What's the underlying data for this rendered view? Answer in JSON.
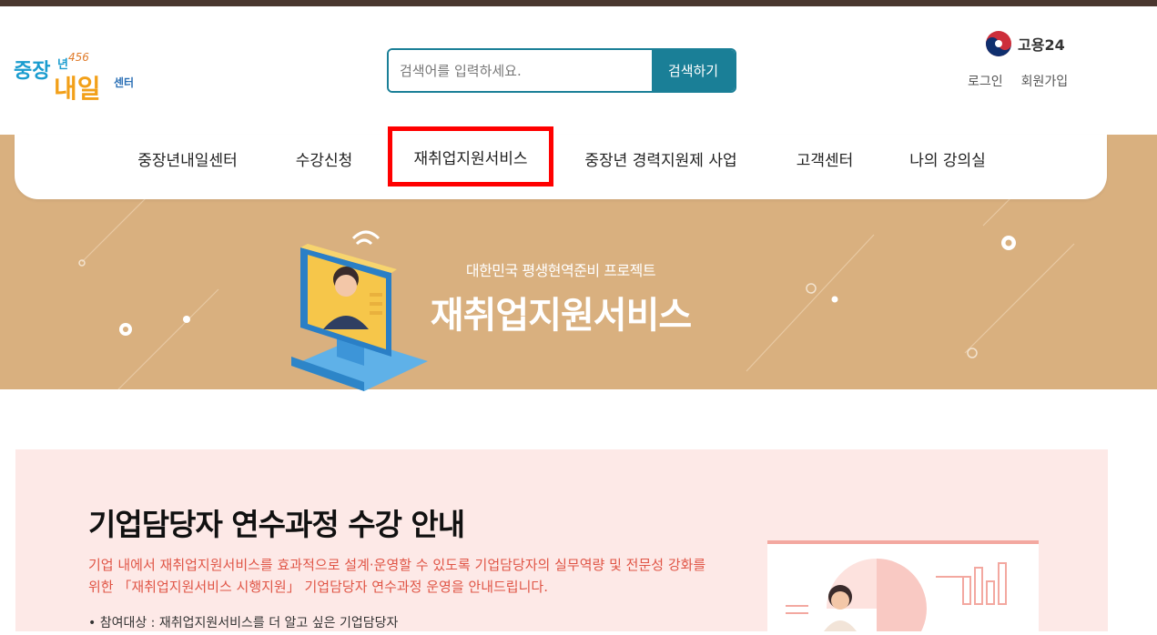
{
  "brand": {
    "logo_text": "중장년 내일센터",
    "logo_number": "456",
    "gov_label": "고용24"
  },
  "search": {
    "placeholder": "검색어를 입력하세요.",
    "button_label": "검색하기"
  },
  "auth": {
    "login": "로그인",
    "signup": "회원가입"
  },
  "nav": {
    "items": [
      {
        "label": "중장년내일센터"
      },
      {
        "label": "수강신청"
      },
      {
        "label": "재취업지원서비스",
        "highlighted": true
      },
      {
        "label": "중장년 경력지원제 사업"
      },
      {
        "label": "고객센터"
      },
      {
        "label": "나의 강의실"
      }
    ]
  },
  "hero": {
    "subtitle": "대한민국 평생현역준비 프로젝트",
    "title": "재취업지원서비스"
  },
  "section": {
    "title": "기업담당자 연수과정 수강 안내",
    "description": "기업 내에서 재취업지원서비스를 효과적으로 설계·운영할 수 있도록 기업담당자의 실무역량 및 전문성 강화를 위한 「재취업지원서비스 시행지원」 기업담당자 연수과정 운영을 안내드립니다.",
    "bullet_fragment": "• 참여대상 : 재취업지원서비스를 더 알고 싶은 기업담당자"
  },
  "colors": {
    "accent": "#1a7f97",
    "band": "#d9b07f",
    "topbar": "#4a372f",
    "card_bg": "#fde9e7",
    "highlight": "#ff0000"
  },
  "icons": [
    "gov-taeguk-icon",
    "monitor-consultant-icon",
    "wifi-signal-icon"
  ]
}
